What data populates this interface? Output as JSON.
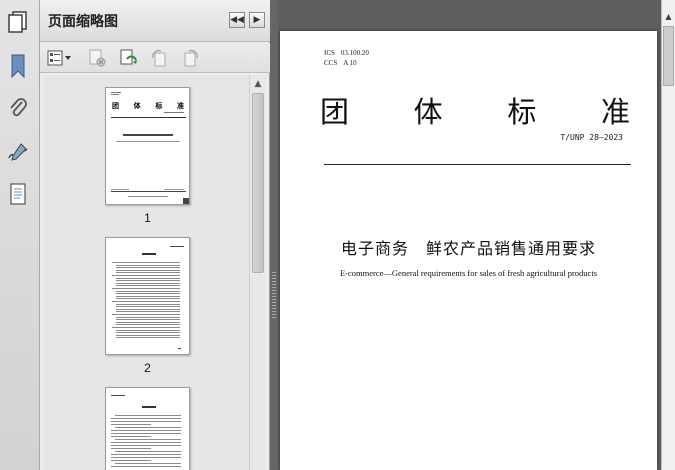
{
  "panel": {
    "title": "页面缩略图",
    "thumbnails": [
      {
        "label": "1"
      },
      {
        "label": "2"
      },
      {
        "label": ""
      }
    ]
  },
  "cover": {
    "ics_label": "ICS",
    "ics_value": "03.100.20",
    "ccs_label": "CCS",
    "ccs_value": "A 10",
    "title_chars": [
      "团",
      "体",
      "标",
      "准"
    ],
    "standard_no": "T/UNP 28—2023",
    "title_cn": "电子商务　鲜农产品销售通用要求",
    "title_en": "E-commerce—General requirements for sales of fresh agricultural products"
  },
  "colors": {
    "panel_bg": "#ececec",
    "doc_bg": "#5e5e5e",
    "splitter": "#666666"
  }
}
